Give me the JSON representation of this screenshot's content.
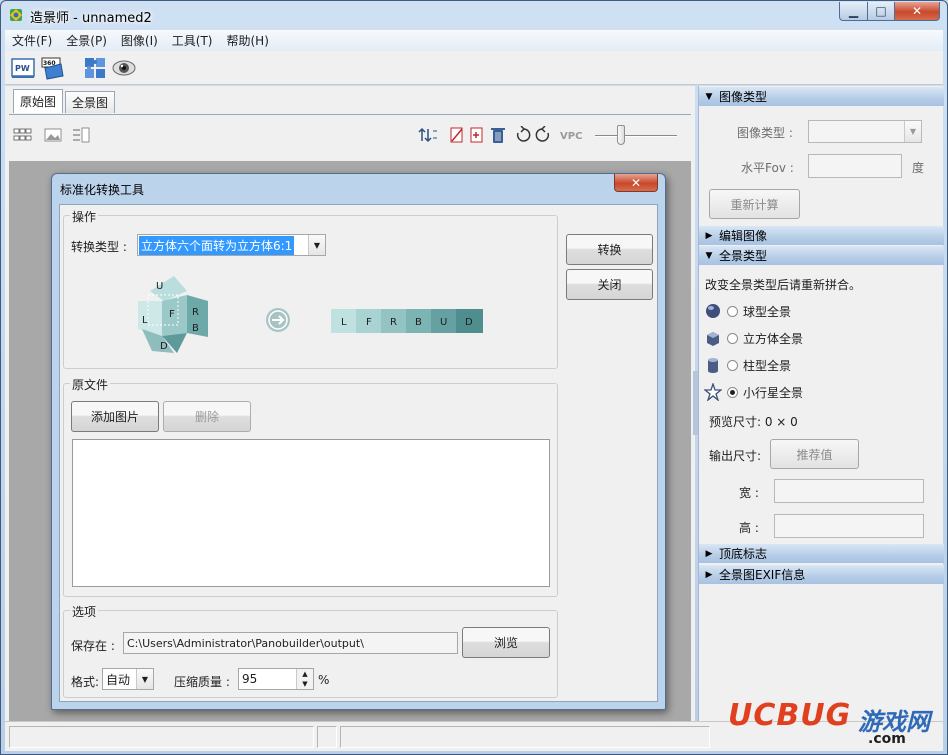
{
  "window": {
    "title": "造景师 - unnamed2"
  },
  "menu": [
    "文件(F)",
    "全景(P)",
    "图像(I)",
    "工具(T)",
    "帮助(H)"
  ],
  "toolbar_icons": [
    "pw-icon",
    "360-icon",
    "puzzle-icon",
    "eye-icon"
  ],
  "tabs": [
    "原始图",
    "全景图"
  ],
  "view_tools": {
    "vpc_label": "VPC"
  },
  "panel": {
    "image_type_section": "图像类型",
    "image_type_label": "图像类型 :",
    "hfov_label": "水平Fov :",
    "hfov_unit": "度",
    "recalc_button": "重新计算",
    "edit_image_section": "编辑图像",
    "pano_type_section": "全景类型",
    "pano_type_note": "改变全景类型后请重新拼合。",
    "pano_types": [
      "球型全景",
      "立方体全景",
      "柱型全景",
      "小行星全景"
    ],
    "selected_pano_type": "小行星全景",
    "preview_size": "预览尺寸: 0 × 0",
    "output_size_label": "输出尺寸:",
    "recommend_button": "推荐值",
    "width_label": "宽 :",
    "height_label": "高 :",
    "nadir_section": "顶底标志",
    "exif_section": "全景图EXIF信息"
  },
  "dialog": {
    "title": "标准化转换工具",
    "close_glyph": "✕",
    "op_group": "操作",
    "convert_type_label": "转换类型 :",
    "convert_type_value": "立方体六个面转为立方体6:1",
    "cube_faces": [
      "U",
      "L",
      "F",
      "R",
      "B",
      "D"
    ],
    "strip_faces": [
      "L",
      "F",
      "R",
      "B",
      "U",
      "D"
    ],
    "convert_button": "转换",
    "close_button": "关闭",
    "source_group": "原文件",
    "add_image_button": "添加图片",
    "delete_button": "删除",
    "options_group": "选项",
    "save_to_label": "保存在 :",
    "save_path": "C:\\Users\\Administrator\\Panobuilder\\output\\",
    "browse_button": "浏览",
    "format_label": "格式:",
    "format_value": "自动",
    "quality_label": "压缩质量 :",
    "quality_value": "95",
    "percent": "%"
  },
  "watermark": {
    "brand": "UCBUG",
    "cn": "游戏网",
    "domain": ".com"
  }
}
